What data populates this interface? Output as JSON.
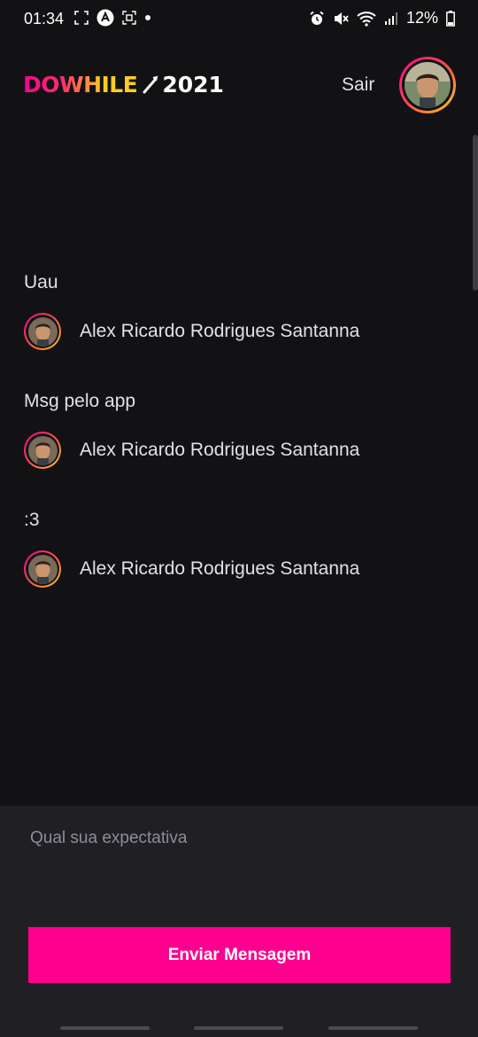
{
  "status_bar": {
    "time": "01:34",
    "battery_text": "12%",
    "icons_left": [
      "screenshot-frame-icon",
      "app-a-icon",
      "screen-record-icon",
      "notification-dot-icon"
    ],
    "icons_right": [
      "alarm-icon",
      "mute-icon",
      "wifi-icon",
      "signal-icon",
      "battery-icon"
    ]
  },
  "header": {
    "logo_text": "DOWHILE",
    "logo_year": "2021",
    "logout_label": "Sair"
  },
  "messages": [
    {
      "text": "Uau",
      "user_name": "Alex Ricardo Rodrigues Santanna"
    },
    {
      "text": "Msg pelo app",
      "user_name": "Alex Ricardo Rodrigues Santanna"
    },
    {
      "text": ":3",
      "user_name": "Alex Ricardo Rodrigues Santanna"
    }
  ],
  "composer": {
    "placeholder": "Qual sua expectativa",
    "value": "",
    "send_label": "Enviar Mensagem"
  },
  "colors": {
    "background": "#121214",
    "composer_background": "#202024",
    "accent": "#ff008e",
    "gradient_end": "#ffcd1e",
    "text": "#e1e1e6",
    "placeholder": "#8d8d99"
  }
}
